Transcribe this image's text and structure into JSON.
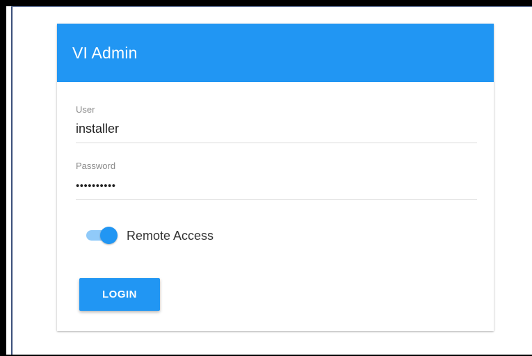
{
  "card": {
    "title": "VI Admin"
  },
  "form": {
    "user": {
      "label": "User",
      "value": "installer"
    },
    "password": {
      "label": "Password",
      "value": "••••••••••"
    },
    "remote_access": {
      "label": "Remote Access",
      "enabled": true
    },
    "login_label": "LOGIN"
  },
  "colors": {
    "accent": "#2196f3",
    "toggle_track": "#90caf9"
  }
}
